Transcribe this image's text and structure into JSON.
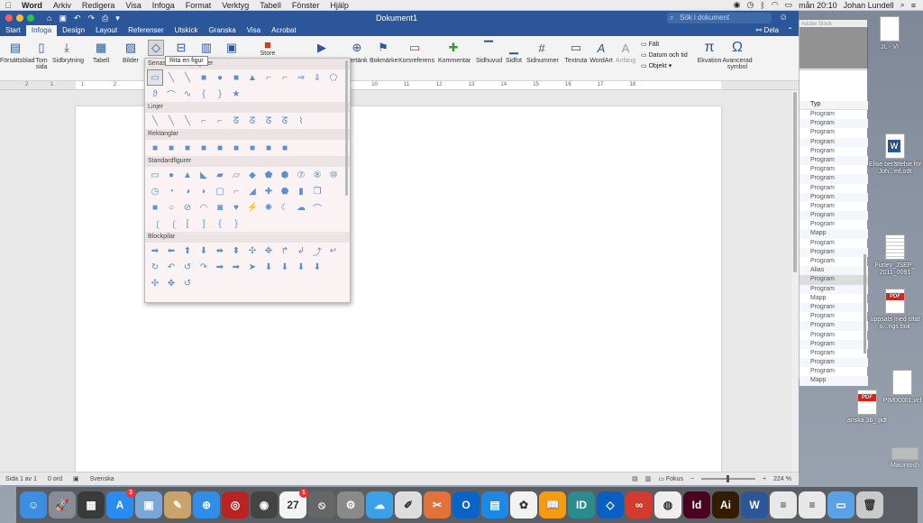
{
  "menubar": {
    "apple": "",
    "items": [
      "Word",
      "Arkiv",
      "Redigera",
      "Visa",
      "Infoga",
      "Format",
      "Verktyg",
      "Tabell",
      "Fönster",
      "Hjälp"
    ],
    "clock": "mån 20:10",
    "user": "Johan Lundell"
  },
  "window": {
    "title": "Dokument1",
    "search_placeholder": "Sök i dokument",
    "share_label": "Dela",
    "tabs": [
      "Start",
      "Infoga",
      "Design",
      "Layout",
      "Referenser",
      "Utskick",
      "Granska",
      "Visa",
      "Acrobat"
    ],
    "active_tab": "Infoga"
  },
  "ribbon": {
    "buttons": [
      {
        "label": "Försättsblad",
        "icon": "cover-page-icon"
      },
      {
        "label": "Tom sida",
        "icon": "blank-page-icon"
      },
      {
        "label": "Sidbrytning",
        "icon": "page-break-icon"
      },
      {
        "label": "Tabell",
        "icon": "table-icon"
      },
      {
        "label": "Bilder",
        "icon": "pictures-icon"
      },
      {
        "label": "Store",
        "icon": "store-icon"
      },
      {
        "label": "pertänk",
        "icon": "link-icon"
      },
      {
        "label": "Bokmärke",
        "icon": "bookmark-icon"
      },
      {
        "label": "Korsreferens",
        "icon": "cross-reference-icon"
      },
      {
        "label": "Kommentar",
        "icon": "comment-icon"
      },
      {
        "label": "Sidhuvud",
        "icon": "header-icon"
      },
      {
        "label": "Sidfot",
        "icon": "footer-icon"
      },
      {
        "label": "Sidnummer",
        "icon": "page-number-icon"
      },
      {
        "label": "Textruta",
        "icon": "text-box-icon"
      },
      {
        "label": "WordArt",
        "icon": "wordart-icon"
      },
      {
        "label": "Anfang",
        "icon": "drop-cap-icon"
      },
      {
        "label": "Ekvation",
        "icon": "equation-icon"
      },
      {
        "label": "Avancerad symbol",
        "icon": "symbol-icon"
      }
    ],
    "small_buttons": [
      "Fält",
      "Datum och tid",
      "Objekt"
    ]
  },
  "ruler": {
    "numbers": [
      "2",
      "1",
      "1",
      "2",
      "3",
      "4",
      "5",
      "6",
      "7",
      "8",
      "9",
      "10",
      "11",
      "12",
      "13",
      "14",
      "15",
      "16",
      "17",
      "18"
    ]
  },
  "shapes_panel": {
    "tooltip": "Rita en figur",
    "sections": [
      {
        "title": "Senast använda figurer",
        "rows": 2
      },
      {
        "title": "Linjer",
        "rows": 1
      },
      {
        "title": "Rektanglar",
        "rows": 1
      },
      {
        "title": "Standardfigurer",
        "rows": 4
      },
      {
        "title": "Blockpilar",
        "rows": 3
      }
    ]
  },
  "statusbar": {
    "page": "Sida 1 av 1",
    "words": "0 ord",
    "language": "Svenska",
    "focus": "Fokus",
    "zoom": "224 %",
    "zoom_level": 0.47
  },
  "finder": {
    "column_header": "Typ",
    "rows": [
      "Program",
      "Program",
      "Program",
      "Program",
      "Program",
      "Program",
      "Program",
      "Program",
      "Program",
      "Program",
      "Program",
      "Program",
      "Program",
      "Mapp",
      "Program",
      "Program",
      "Program",
      "Alias",
      "Program",
      "Program",
      "Mapp",
      "Program",
      "Program",
      "Program",
      "Program",
      "Program",
      "Program",
      "Program",
      "Program",
      "Mapp"
    ],
    "selected_index": 18
  },
  "desktop_icons": [
    {
      "label": "JL - VI",
      "type": "doc"
    },
    {
      "label": "Elise berättelse för Joh...ed.odt",
      "type": "word"
    },
    {
      "label": "Furley_JSEP_ 2011_0091",
      "type": "txt"
    },
    {
      "label": "uppsats med citat o...ngs bok",
      "type": "pdf"
    },
    {
      "label": "PIM00001.vcf",
      "type": "doc"
    },
    {
      "label": "anska 3b_.pdf",
      "type": "pdf"
    },
    {
      "label": "Macintosh",
      "type": "disk"
    }
  ],
  "dock": {
    "apps": [
      {
        "name": "finder-icon",
        "bg": "#3d8de0",
        "glyph": "☺"
      },
      {
        "name": "launchpad-icon",
        "bg": "#888c94",
        "glyph": "🚀"
      },
      {
        "name": "mission-control-icon",
        "bg": "#3a3a3a",
        "glyph": "▦"
      },
      {
        "name": "app-store-icon",
        "bg": "#2a8cf0",
        "glyph": "A",
        "badge": "3"
      },
      {
        "name": "preview-icon",
        "bg": "#7aa7d8",
        "glyph": "▣"
      },
      {
        "name": "notes-icon",
        "bg": "#c9a36a",
        "glyph": "✎"
      },
      {
        "name": "safari-icon",
        "bg": "#2f8fe8",
        "glyph": "⊕"
      },
      {
        "name": "photo-booth-icon",
        "bg": "#b22",
        "glyph": "◎"
      },
      {
        "name": "photos-icon",
        "bg": "#444",
        "glyph": "◉"
      },
      {
        "name": "calendar-icon",
        "bg": "#f4f4f4",
        "glyph": "27",
        "badge": "1"
      },
      {
        "name": "no-entry-icon",
        "bg": "#666",
        "glyph": "⦸"
      },
      {
        "name": "system-preferences-icon",
        "bg": "#8a8a8a",
        "glyph": "⚙"
      },
      {
        "name": "icloud-icon",
        "bg": "#3aa0e8",
        "glyph": "☁"
      },
      {
        "name": "textedit-icon",
        "bg": "#ddd",
        "glyph": "✐"
      },
      {
        "name": "scrapbook-icon",
        "bg": "#e1733a",
        "glyph": "✂"
      },
      {
        "name": "outlook-icon",
        "bg": "#0a64c8",
        "glyph": "O"
      },
      {
        "name": "keynote-icon",
        "bg": "#1e88e5",
        "glyph": "▤"
      },
      {
        "name": "photos-app-icon",
        "bg": "#f2f2f2",
        "glyph": "✿"
      },
      {
        "name": "ibooks-icon",
        "bg": "#f39c12",
        "glyph": "📖"
      },
      {
        "name": "bankid-icon",
        "bg": "#2a8c8c",
        "glyph": "ID"
      },
      {
        "name": "dropbox-icon",
        "bg": "#0a5fc2",
        "glyph": "◇"
      },
      {
        "name": "creative-cloud-icon",
        "bg": "#d23b2d",
        "glyph": "∞"
      },
      {
        "name": "chrome-icon",
        "bg": "#eee",
        "glyph": "◍"
      },
      {
        "name": "indesign-icon",
        "bg": "#49021f",
        "glyph": "Id"
      },
      {
        "name": "illustrator-icon",
        "bg": "#331c04",
        "glyph": "Ai"
      },
      {
        "name": "word-icon",
        "bg": "#2b579a",
        "glyph": "W"
      },
      {
        "name": "document-icon",
        "bg": "#e8e8e8",
        "glyph": "≡"
      },
      {
        "name": "document2-icon",
        "bg": "#e8e8e8",
        "glyph": "≡"
      },
      {
        "name": "downloads-folder-icon",
        "bg": "#5aa2e6",
        "glyph": "▭"
      },
      {
        "name": "trash-icon",
        "bg": "#c9c9c9",
        "glyph": "🗑"
      }
    ]
  },
  "colors": {
    "word_blue": "#2b579a",
    "shape_blue": "#5b8fd0"
  }
}
